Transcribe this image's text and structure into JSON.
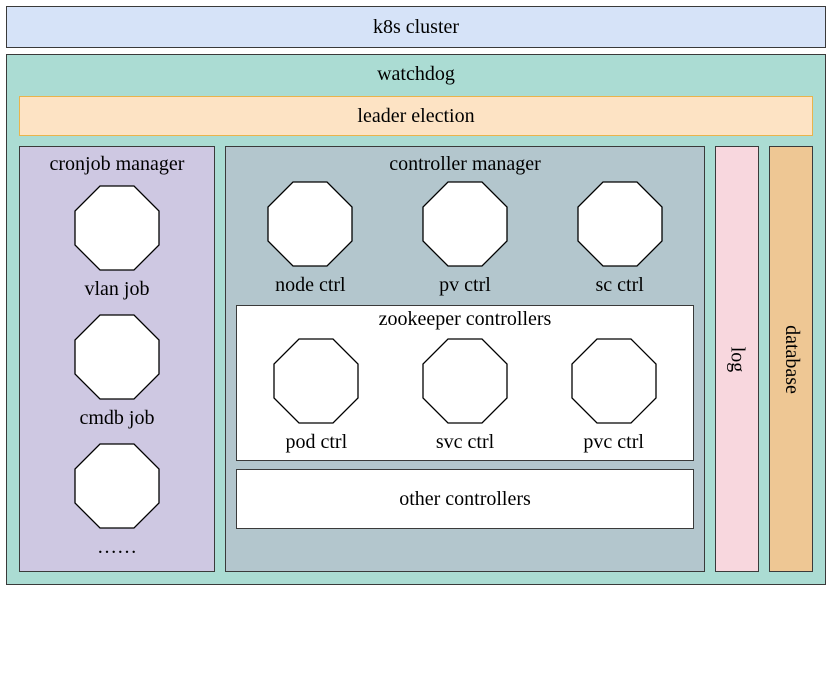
{
  "k8s_title": "k8s cluster",
  "watchdog": {
    "title": "watchdog",
    "leader_label": "leader election",
    "cronjob": {
      "title": "cronjob manager",
      "jobs": [
        "vlan job",
        "cmdb job",
        "……"
      ]
    },
    "controller_manager": {
      "title": "controller manager",
      "controllers": [
        "node ctrl",
        "pv ctrl",
        "sc ctrl"
      ],
      "zookeeper": {
        "title": "zookeeper controllers",
        "controllers": [
          "pod ctrl",
          "svc ctrl",
          "pvc ctrl"
        ]
      },
      "other_label": "other controllers"
    },
    "log_label": "log",
    "database_label": "database"
  },
  "colors": {
    "k8s": "#d6e3f8",
    "watchdog": "#abdcd3",
    "leader": "#fde3c4",
    "cronjob": "#cec8e2",
    "ctrlmgr": "#b3c6cd",
    "log": "#f8d7de",
    "database": "#eec794"
  }
}
